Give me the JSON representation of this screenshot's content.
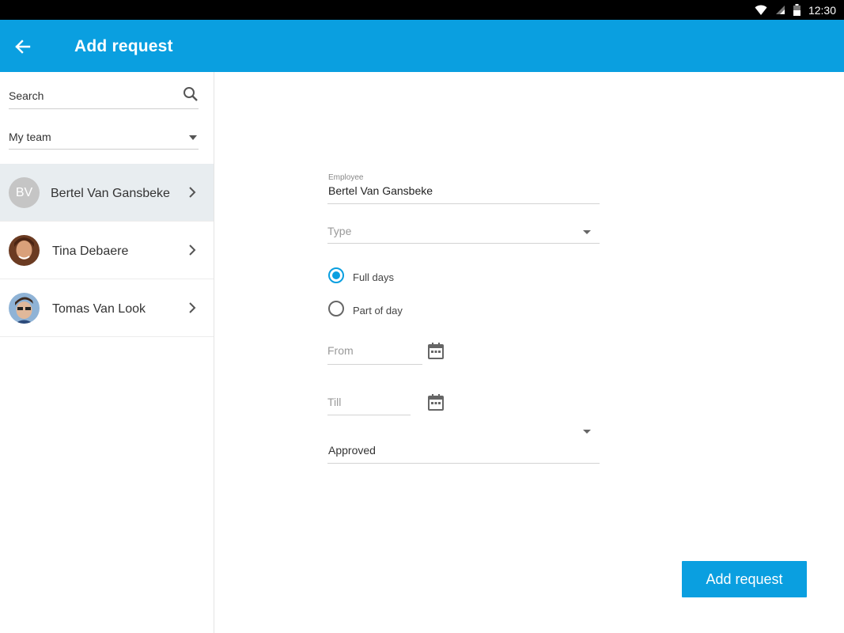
{
  "status_bar": {
    "time": "12:30"
  },
  "app_bar": {
    "title": "Add request"
  },
  "sidebar": {
    "search_placeholder": "Search",
    "filter_value": "My team",
    "employees": [
      {
        "name": "Bertel Van Gansbeke",
        "initials": "BV",
        "active": true
      },
      {
        "name": "Tina Debaere",
        "initials": "",
        "active": false
      },
      {
        "name": "Tomas Van Look",
        "initials": "",
        "active": false
      }
    ]
  },
  "form": {
    "employee_label": "Employee",
    "employee_value": "Bertel Van Gansbeke",
    "type_placeholder": "Type",
    "duration_options": [
      "Full days",
      "Part of day"
    ],
    "duration_selected": "Full days",
    "from_placeholder": "From",
    "till_placeholder": "Till",
    "status_value": "Approved",
    "submit_label": "Add request"
  },
  "colors": {
    "accent": "#0a9fe0",
    "status_bar": "#000000"
  }
}
